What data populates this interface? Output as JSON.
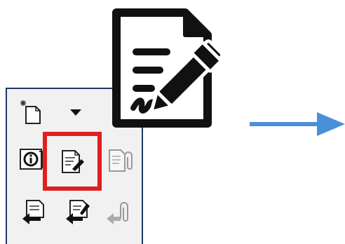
{
  "colors": {
    "panel_border": "#1f3864",
    "highlight": "#e02020",
    "arrow": "#4a90d9"
  },
  "toolbar": {
    "tools": [
      {
        "name": "new-document-sparkle-icon"
      },
      {
        "name": "dropdown-triangle-icon"
      },
      {
        "name": "info-document-icon"
      },
      {
        "name": "sign-document-icon"
      },
      {
        "name": "attach-document-icon"
      },
      {
        "name": "send-document-icon"
      },
      {
        "name": "send-signed-document-icon"
      },
      {
        "name": "hand-attach-icon"
      }
    ],
    "highlighted": "sign-document-icon"
  },
  "illustration": {
    "icon": "document-signature-icon"
  },
  "arrow": {
    "icon": "right-arrow-icon"
  }
}
